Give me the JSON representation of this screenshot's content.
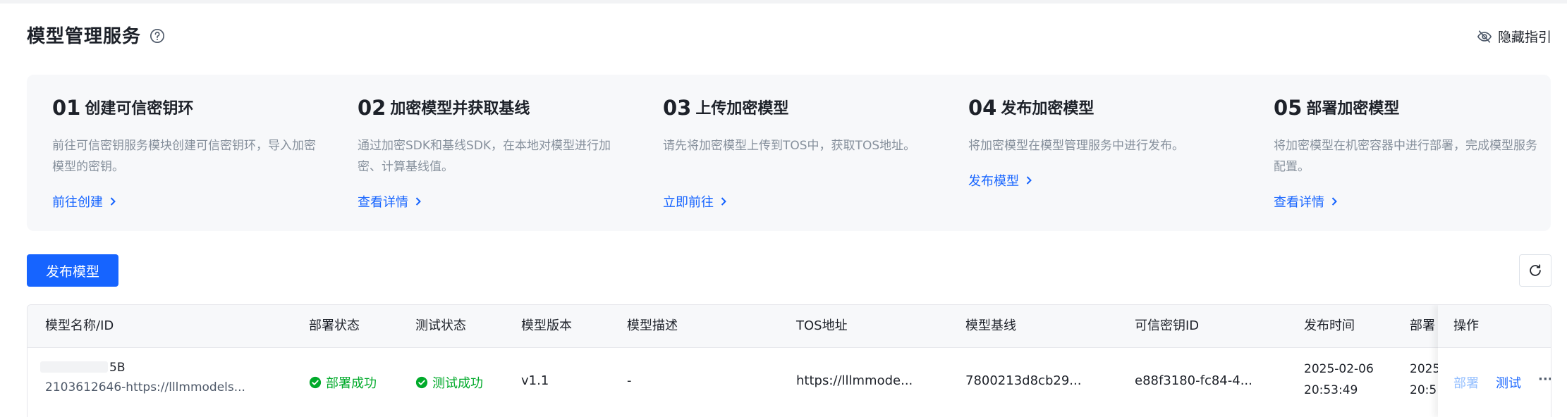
{
  "header": {
    "title": "模型管理服务",
    "hide_guide_label": "隐藏指引"
  },
  "guide": {
    "steps": [
      {
        "num": "01",
        "title": "创建可信密钥环",
        "desc": "前往可信密钥服务模块创建可信密钥环，导入加密模型的密钥。",
        "link": "前往创建"
      },
      {
        "num": "02",
        "title": "加密模型并获取基线",
        "desc": "通过加密SDK和基线SDK，在本地对模型进行加密、计算基线值。",
        "link": "查看详情"
      },
      {
        "num": "03",
        "title": "上传加密模型",
        "desc": "请先将加密模型上传到TOS中，获取TOS地址。",
        "link": "立即前往"
      },
      {
        "num": "04",
        "title": "发布加密模型",
        "desc": "将加密模型在模型管理服务中进行发布。",
        "link": "发布模型"
      },
      {
        "num": "05",
        "title": "部署加密模型",
        "desc": "将加密模型在机密容器中进行部署，完成模型服务配置。",
        "link": "查看详情"
      }
    ]
  },
  "toolbar": {
    "publish_label": "发布模型"
  },
  "table": {
    "columns": [
      "模型名称/ID",
      "部署状态",
      "测试状态",
      "模型版本",
      "模型描述",
      "TOS地址",
      "模型基线",
      "可信密钥ID",
      "发布时间",
      "部署",
      "操作"
    ],
    "rows": [
      {
        "name": "5B",
        "id": "2103612646-https://lllmmodels...",
        "deploy_status": "部署成功",
        "test_status": "测试成功",
        "version": "v1.1",
        "description": "-",
        "tos": "https://lllmmode...",
        "baseline": "7800213d8cb29...",
        "key_id": "e88f3180-fc84-4...",
        "publish_date": "2025-02-06",
        "publish_time": "20:53:49",
        "deploy_date_partial": "2025",
        "deploy_time_partial": "20:5",
        "actions": {
          "deploy": "部署",
          "test": "测试",
          "more": "···"
        }
      }
    ]
  },
  "colors": {
    "primary": "#1664ff",
    "success": "#00aa2a",
    "muted": "#86909c",
    "disabled_link": "#94bfff"
  }
}
